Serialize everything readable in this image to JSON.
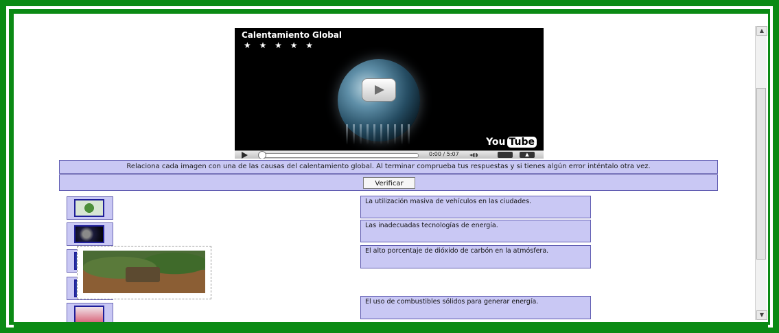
{
  "video": {
    "title": "Calentamiento Global",
    "rating_stars": "★ ★ ★ ★ ★",
    "time": "0:00 / 5:07",
    "logo_you": "You",
    "logo_tube": "Tube"
  },
  "activity": {
    "instructions": "Relaciona cada imagen con una de las causas del calentamiento global. Al terminar comprueba tus respuestas y si tienes algún error inténtalo otra vez.",
    "verify_label": "Verificar",
    "statements": [
      "La utilización masiva de vehículos en las ciudades.",
      "Las inadecuadas tecnologías de energía.",
      "El alto porcentaje de dióxido de carbón en la atmósfera.",
      "El uso de combustibles sólidos para generar energía."
    ]
  },
  "colors": {
    "frame_green": "#0b8a14",
    "panel_lavender": "#c9c8f4",
    "panel_border": "#5e5ab0"
  }
}
